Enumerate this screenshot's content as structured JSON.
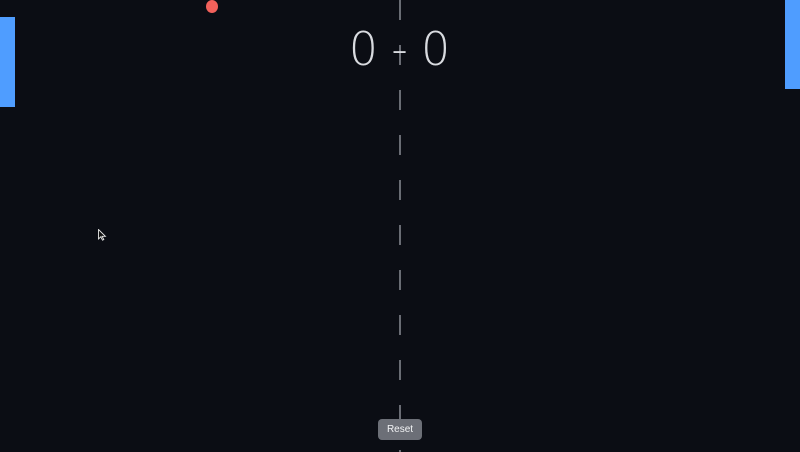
{
  "score": {
    "left": "0",
    "separator": "-",
    "right": "0"
  },
  "controls": {
    "reset_label": "Reset"
  },
  "colors": {
    "background": "#0b0d14",
    "paddle": "#4f9dff",
    "ball": "#f2615b",
    "center_line": "#7a7d85",
    "score_text": "#d9dbe0",
    "button": "#6c6f77"
  },
  "icons": {
    "cursor": "mouse-pointer-icon"
  }
}
